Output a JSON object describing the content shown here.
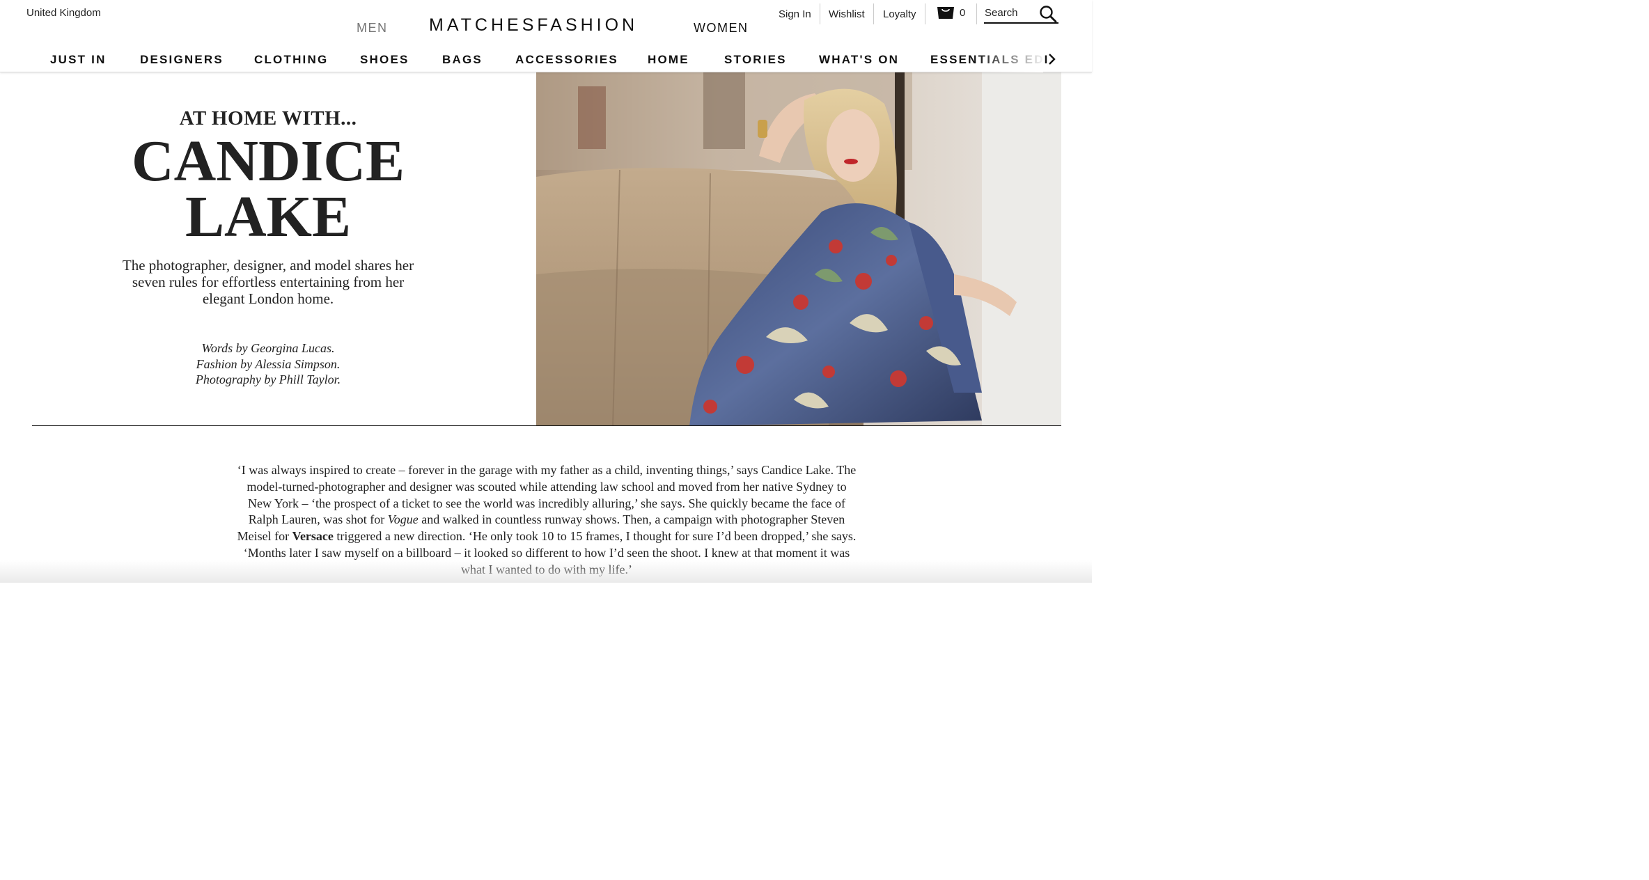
{
  "header": {
    "region": "United Kingdom",
    "men_label": "MEN",
    "logo_text": "MATCHESFASHION",
    "women_label": "WOMEN",
    "sign_in": "Sign In",
    "wishlist": "Wishlist",
    "loyalty": "Loyalty",
    "bag_count": "0",
    "search_label": "Search"
  },
  "nav": {
    "items": [
      "JUST IN",
      "DESIGNERS",
      "CLOTHING",
      "SHOES",
      "BAGS",
      "ACCESSORIES",
      "HOME",
      "STORIES",
      "WHAT'S ON",
      "ESSENTIALS EDI"
    ]
  },
  "hero": {
    "kicker": "AT HOME WITH...",
    "headline_line1": "CANDICE",
    "headline_line2": "LAKE",
    "dek": "The photographer, designer, and model shares her seven rules for effortless entertaining from her elegant London home.",
    "credit_words": "Words by Georgina Lucas.",
    "credit_fashion": "Fashion by Alessia Simpson.",
    "credit_photo": "Photography by Phill Taylor."
  },
  "article": {
    "p1_a": "‘I was always inspired to create – forever in the garage with my father as a child, inventing things,’ says Candice Lake. The model-turned-photographer and designer was scouted while attending law school and moved from her native Sydney to New York – ‘the prospect of a ticket to see the world was incredibly alluring,’ she says. She quickly became the face of Ralph Lauren, was shot for ",
    "p1_vogue": "Vogue",
    "p1_b": " and walked in countless runway shows. Then, a campaign with photographer Steven Meisel for ",
    "p1_versace": "Versace",
    "p1_c": " triggered a new direction. ‘He only took 10 to 15 frames, I thought for sure I’d been dropped,’ she says. ‘Months later I saw myself on a billboard – it looked so different to how I’d seen the shoot. I knew at that moment it was what I wanted to do with my life.’"
  },
  "colors": {
    "text": "#111111",
    "muted": "#777777",
    "rule": "#111111"
  }
}
